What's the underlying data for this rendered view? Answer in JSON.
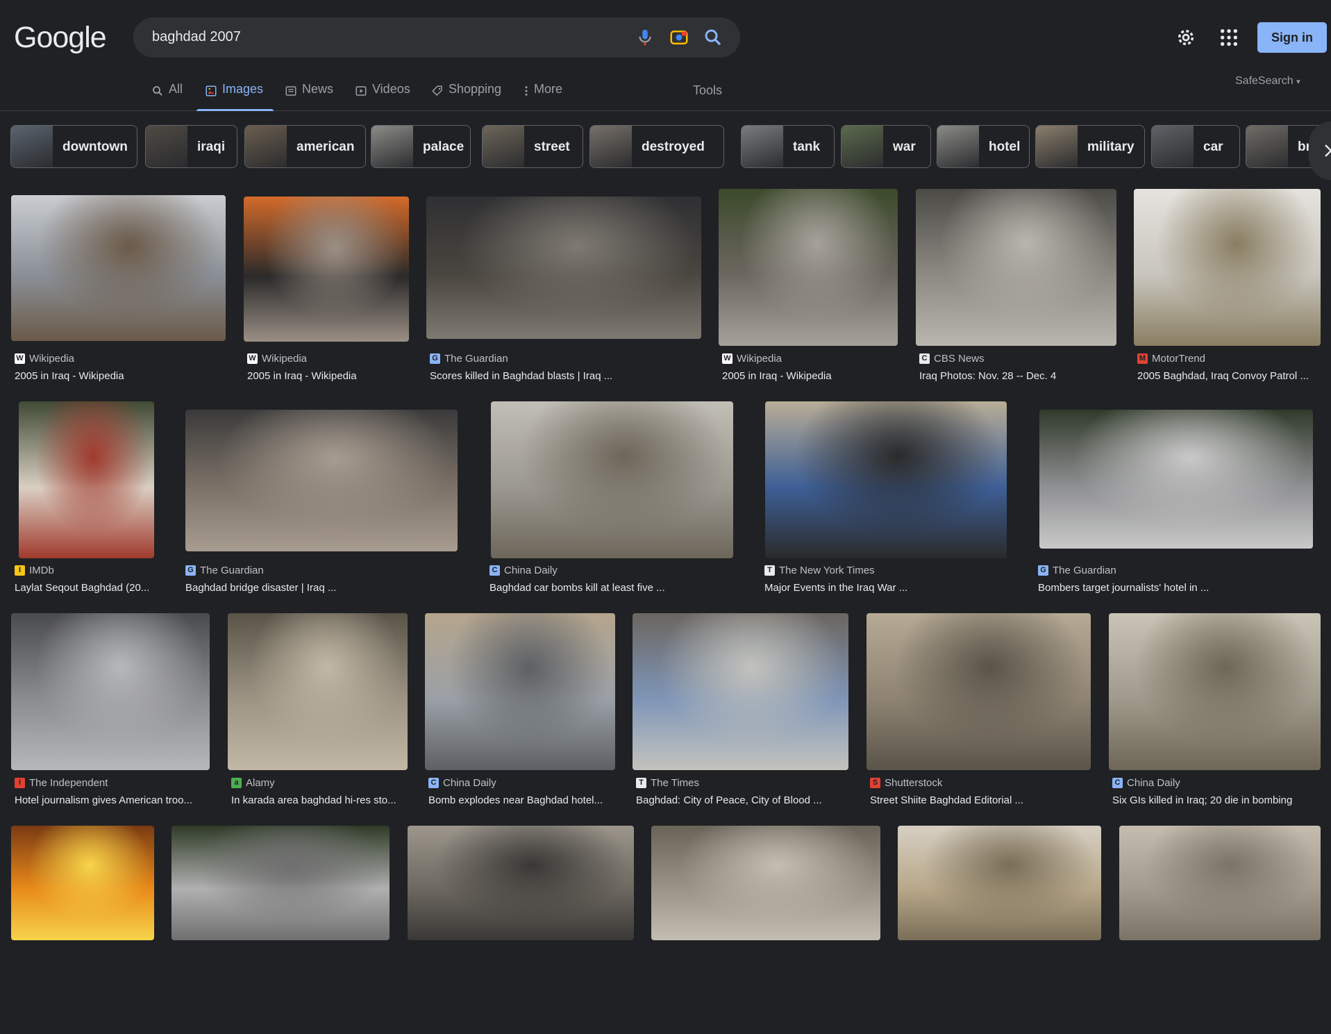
{
  "logo": "Google",
  "search": {
    "query": "baghdad 2007"
  },
  "header": {
    "signin": "Sign in"
  },
  "tabs": [
    {
      "label": "All",
      "icon": "search-icon"
    },
    {
      "label": "Images",
      "icon": "image-icon"
    },
    {
      "label": "News",
      "icon": "news-icon"
    },
    {
      "label": "Videos",
      "icon": "video-icon"
    },
    {
      "label": "Shopping",
      "icon": "tag-icon"
    },
    {
      "label": "More",
      "icon": "more-vert-icon"
    }
  ],
  "tools": "Tools",
  "safesearch": "SafeSearch",
  "chips": [
    "downtown",
    "iraqi",
    "american",
    "palace",
    "street",
    "destroyed",
    "tank",
    "war",
    "hotel",
    "military",
    "car",
    "bridg"
  ],
  "results": [
    {
      "source": "Wikipedia",
      "title": "2005 in Iraq - Wikipedia",
      "fav": "W",
      "favColor": "#ffffff",
      "colors": [
        "#8a8f96",
        "#6b5a48",
        "#c9cdd2"
      ]
    },
    {
      "source": "Wikipedia",
      "title": "2005 in Iraq - Wikipedia",
      "fav": "W",
      "favColor": "#ffffff",
      "colors": [
        "#2b2a2a",
        "#9a8f85",
        "#d36a2a"
      ]
    },
    {
      "source": "The Guardian",
      "title": "Scores killed in Baghdad blasts | Iraq ...",
      "fav": "G",
      "favColor": "#8ab4f8",
      "colors": [
        "#4a4640",
        "#7e7a72",
        "#2f3032"
      ]
    },
    {
      "source": "Wikipedia",
      "title": "2005 in Iraq - Wikipedia",
      "fav": "W",
      "favColor": "#ffffff",
      "colors": [
        "#6c6760",
        "#a6a29b",
        "#3c4a2b"
      ]
    },
    {
      "source": "CBS News",
      "title": "Iraq Photos: Nov. 28 -- Dec. 4",
      "fav": "C",
      "favColor": "#e8eaed",
      "colors": [
        "#8d8a83",
        "#b9b6ae",
        "#4b4a45"
      ]
    },
    {
      "source": "MotorTrend",
      "title": "2005 Baghdad, Iraq Convoy Patrol ...",
      "fav": "M",
      "favColor": "#e34133",
      "colors": [
        "#c8c5bd",
        "#8a7e62",
        "#e5e3de"
      ]
    },
    {
      "source": "IMDb",
      "title": "Laylat Seqout Baghdad (20...",
      "fav": "I",
      "favColor": "#f5c518",
      "colors": [
        "#d9cfc2",
        "#a13a2e",
        "#3f4a34"
      ]
    },
    {
      "source": "The Guardian",
      "title": "Baghdad bridge disaster | Iraq ...",
      "fav": "G",
      "favColor": "#8ab4f8",
      "colors": [
        "#7d7268",
        "#a89c90",
        "#3a3a3a"
      ]
    },
    {
      "source": "China Daily",
      "title": "Baghdad car bombs kill at least five ...",
      "fav": "C",
      "favColor": "#8ab4f8",
      "colors": [
        "#9b9890",
        "#6d665a",
        "#c1beb6"
      ]
    },
    {
      "source": "The New York Times",
      "title": "Major Events in the Iraq War ...",
      "fav": "T",
      "favColor": "#e8eaed",
      "colors": [
        "#3d5f96",
        "#2a2a2a",
        "#b8ad97"
      ]
    },
    {
      "source": "The Guardian",
      "title": "Bombers target journalists' hotel in ...",
      "fav": "G",
      "favColor": "#8ab4f8",
      "colors": [
        "#8e8f91",
        "#c9c9c9",
        "#303a2a"
      ]
    },
    {
      "source": "The Independent",
      "title": "Hotel journalism gives American troo...",
      "fav": "I",
      "favColor": "#e34133",
      "colors": [
        "#8b8c8e",
        "#b7b8ba",
        "#4a4b4d"
      ]
    },
    {
      "source": "Alamy",
      "title": "In karada area baghdad hi-res sto...",
      "fav": "a",
      "favColor": "#4caf50",
      "colors": [
        "#9d9484",
        "#c2b8a5",
        "#5a5448"
      ]
    },
    {
      "source": "China Daily",
      "title": "Bomb explodes near Baghdad hotel...",
      "fav": "C",
      "favColor": "#8ab4f8",
      "colors": [
        "#9aa0a6",
        "#5d6064",
        "#b5a58c"
      ]
    },
    {
      "source": "The Times",
      "title": "Baghdad: City of Peace, City of Blood ...",
      "fav": "T",
      "favColor": "#e8eaed",
      "colors": [
        "#7f96b8",
        "#c3c3bd",
        "#6a6660"
      ]
    },
    {
      "source": "Shutterstock",
      "title": "Street Shiite Baghdad Editorial ...",
      "fav": "S",
      "favColor": "#e34133",
      "colors": [
        "#8e8372",
        "#5a5449",
        "#b6aa95"
      ]
    },
    {
      "source": "China Daily",
      "title": "Six GIs killed in Iraq; 20 die in bombing",
      "fav": "C",
      "favColor": "#8ab4f8",
      "colors": [
        "#a09a8c",
        "#6e6656",
        "#cac4b6"
      ]
    },
    {
      "source": "",
      "title": "",
      "fav": "",
      "favColor": "#202124",
      "colors": [
        "#e88a1a",
        "#f7d44a",
        "#7a3a12"
      ]
    },
    {
      "source": "",
      "title": "",
      "fav": "",
      "favColor": "#202124",
      "colors": [
        "#b0b0b0",
        "#6f6f6f",
        "#2e3a26"
      ]
    },
    {
      "source": "",
      "title": "",
      "fav": "",
      "favColor": "#202124",
      "colors": [
        "#6d6860",
        "#3a3836",
        "#9c968c"
      ]
    },
    {
      "source": "",
      "title": "",
      "fav": "",
      "favColor": "#202124",
      "colors": [
        "#9a9488",
        "#c4beb2",
        "#6a6458"
      ]
    },
    {
      "source": "",
      "title": "",
      "fav": "",
      "favColor": "#202124",
      "colors": [
        "#b8a88a",
        "#7a6e58",
        "#d6cfc2"
      ]
    },
    {
      "source": "",
      "title": "",
      "fav": "",
      "favColor": "#202124",
      "colors": [
        "#a39c8e",
        "#7b7466",
        "#c4bcae"
      ]
    }
  ]
}
